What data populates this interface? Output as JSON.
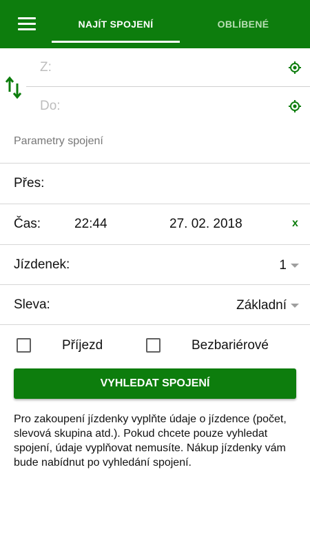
{
  "header": {
    "tabs": [
      {
        "label": "NAJÍT SPOJENÍ",
        "active": true
      },
      {
        "label": "OBLÍBENÉ",
        "active": false
      }
    ],
    "menu_icon": "hamburger-menu-icon",
    "background": "#0d7d0d"
  },
  "route": {
    "from_placeholder": "Z:",
    "to_placeholder": "Do:",
    "swap_icon": "swap-arrows-icon",
    "locate_icon": "target-location-icon"
  },
  "params": {
    "title": "Parametry spojení",
    "via_label": "Přes:",
    "time_label": "Čas:",
    "time_value": "22:44",
    "date_value": "27. 02. 2018",
    "clear_label": "x",
    "tickets_label": "Jízdenek:",
    "tickets_value": "1",
    "discount_label": "Sleva:",
    "discount_value": "Základní"
  },
  "options": {
    "arrival_label": "Příjezd",
    "arrival_checked": false,
    "barrier_free_label": "Bezbariérové",
    "barrier_free_checked": false
  },
  "search_button": "VYHLEDAT SPOJENÍ",
  "info_text": "Pro zakoupení jízdenky vyplňte údaje o jízdence (počet, slevová skupina atd.). Pokud chcete pouze vyhledat spojení, údaje vyplňovat nemusíte. Nákup jízdenky vám bude nabídnut po vyhledání spojení.",
  "colors": {
    "accent": "#0d7d0d",
    "inactive_tab": "#b9dfb4"
  }
}
